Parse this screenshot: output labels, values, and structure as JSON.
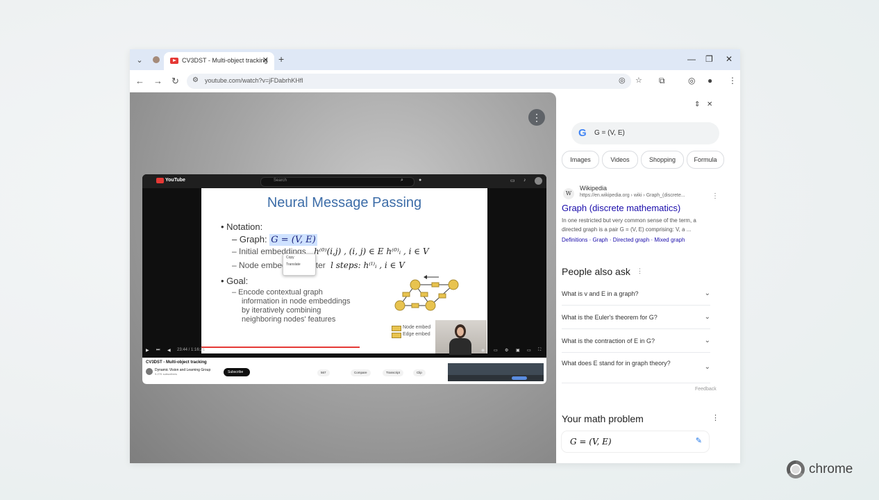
{
  "browser": {
    "tab": {
      "title": "CV3DST - Multi-object tracking"
    },
    "address": "youtube.com/watch?v=jFDabrhKHfl"
  },
  "youtube": {
    "logo": "YouTube",
    "search_placeholder": "Search",
    "slide": {
      "title": "Neural Message Passing",
      "notation": "Notation:",
      "graph_label": "– Graph:",
      "graph_eq": "G = (V, E)",
      "initial_label": "– Initial embeddings",
      "initial_eq": "h⁽⁰⁾(i,j) , (i, j) ∈ E   h⁽⁰⁾ᵢ , i ∈ V",
      "node_label": "– Node embeddings after",
      "node_eq": "l steps: h⁽ˡ⁾ᵢ , i ∈ V",
      "goal": "Goal:",
      "goal_text": [
        "– Encode contextual graph",
        "information in node embeddings",
        "by iteratively combining",
        "neighboring nodes' features"
      ],
      "legend": [
        "Node embed",
        "Edge embed"
      ],
      "popup": [
        "Copy",
        "Translate"
      ]
    },
    "time": "23:44 / 1:16:21",
    "video_title": "CV3DST - Multi-object tracking",
    "channel": "Dynamic Vision and Learning Group",
    "channel_sub": "9.27K subscribers",
    "subscribe": "Subscribe",
    "actions": [
      "567",
      "Compare",
      "Transcript",
      "Clip"
    ]
  },
  "side_panel": {
    "query": "G = (V, E)",
    "chips": [
      "Images",
      "Videos",
      "Shopping",
      "Formula"
    ],
    "result": {
      "source": "Wikipedia",
      "url": "https://en.wikipedia.org › wiki › Graph_(discrete...",
      "title": "Graph (discrete mathematics)",
      "snippet": "In one restricted but very common sense of the term, a directed graph is a pair G = (V, E) comprising: V, a ...",
      "links": "Definitions · Graph · Directed graph · Mixed graph"
    },
    "people_also_ask": {
      "title": "People also ask",
      "questions": [
        "What is v and E in a graph?",
        "What is the Euler's theorem for G?",
        "What is the contraction of E in G?",
        "What does E stand for in graph theory?"
      ]
    },
    "feedback": "Feedback",
    "math": {
      "title": "Your math problem",
      "equation": "G = (V, E)"
    }
  },
  "brand": "chrome",
  "icons": {
    "back": "arrow-left-icon",
    "forward": "arrow-right-icon",
    "reload": "reload-icon",
    "bookmark": "star-icon",
    "extensions": "puzzle-icon",
    "menu": "kebab-icon"
  }
}
